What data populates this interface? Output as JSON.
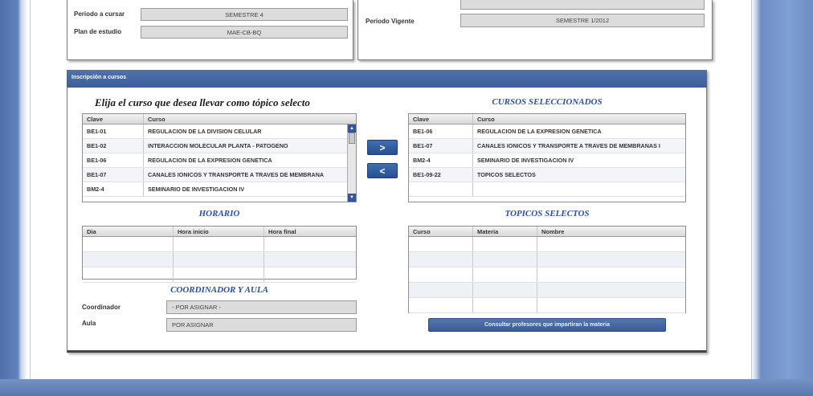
{
  "top_left": {
    "periodo_label": "Periodo a cursar",
    "periodo_value": "SEMESTRE 4",
    "plan_label": "Plan de estudio",
    "plan_value": "MAE-CB-BQ"
  },
  "top_right": {
    "vigente_label": "Periodo Vigente",
    "vigente_value": "SEMESTRE 1/2012"
  },
  "section": {
    "title": "Inscripción a cursos"
  },
  "available": {
    "heading": "Elija el curso que desea llevar como tópico selecto",
    "headers": [
      "Clave",
      "Curso"
    ],
    "rows": [
      {
        "clave": "BE1-01",
        "curso": "REGULACION DE LA DIVISION CELULAR"
      },
      {
        "clave": "BE1-02",
        "curso": "INTERACCION MOLECULAR PLANTA - PATOGENO"
      },
      {
        "clave": "BE1-06",
        "curso": "REGULACION DE LA EXPRESION GENETICA"
      },
      {
        "clave": "BE1-07",
        "curso": "CANALES IONICOS Y TRANSPORTE A TRAVES DE MEMBRANA"
      },
      {
        "clave": "BM2-4",
        "curso": "SEMINARIO DE INVESTIGACION IV"
      }
    ]
  },
  "transfer": {
    "add_label": ">",
    "remove_label": "<"
  },
  "selected": {
    "heading": "CURSOS SELECCIONADOS",
    "headers": [
      "Clave",
      "Curso"
    ],
    "rows": [
      {
        "clave": "BE1-06",
        "curso": "REGULACION DE LA EXPRESION GENETICA"
      },
      {
        "clave": "BE1-07",
        "curso": "CANALES IONICOS Y TRANSPORTE A TRAVES DE MEMBRANAS I"
      },
      {
        "clave": "BM2-4",
        "curso": "SEMINARIO DE INVESTIGACION IV"
      },
      {
        "clave": "BE1-09-22",
        "curso": "TOPICOS SELECTOS"
      }
    ]
  },
  "horario": {
    "heading": "HORARIO",
    "headers": [
      "Dia",
      "Hora inicio",
      "Hora final"
    ]
  },
  "topicos": {
    "heading": "TOPICOS SELECTOS",
    "headers": [
      "Curso",
      "Materia",
      "Nombre"
    ]
  },
  "coordinador": {
    "heading": "COORDINADOR Y AULA",
    "coord_label": "Coordinador",
    "coord_value": "- POR ASIGNAR -",
    "aula_label": "Aula",
    "aula_value": "POR ASIGNAR"
  },
  "consult_button": "Consultar profesores que impartiran la materia"
}
